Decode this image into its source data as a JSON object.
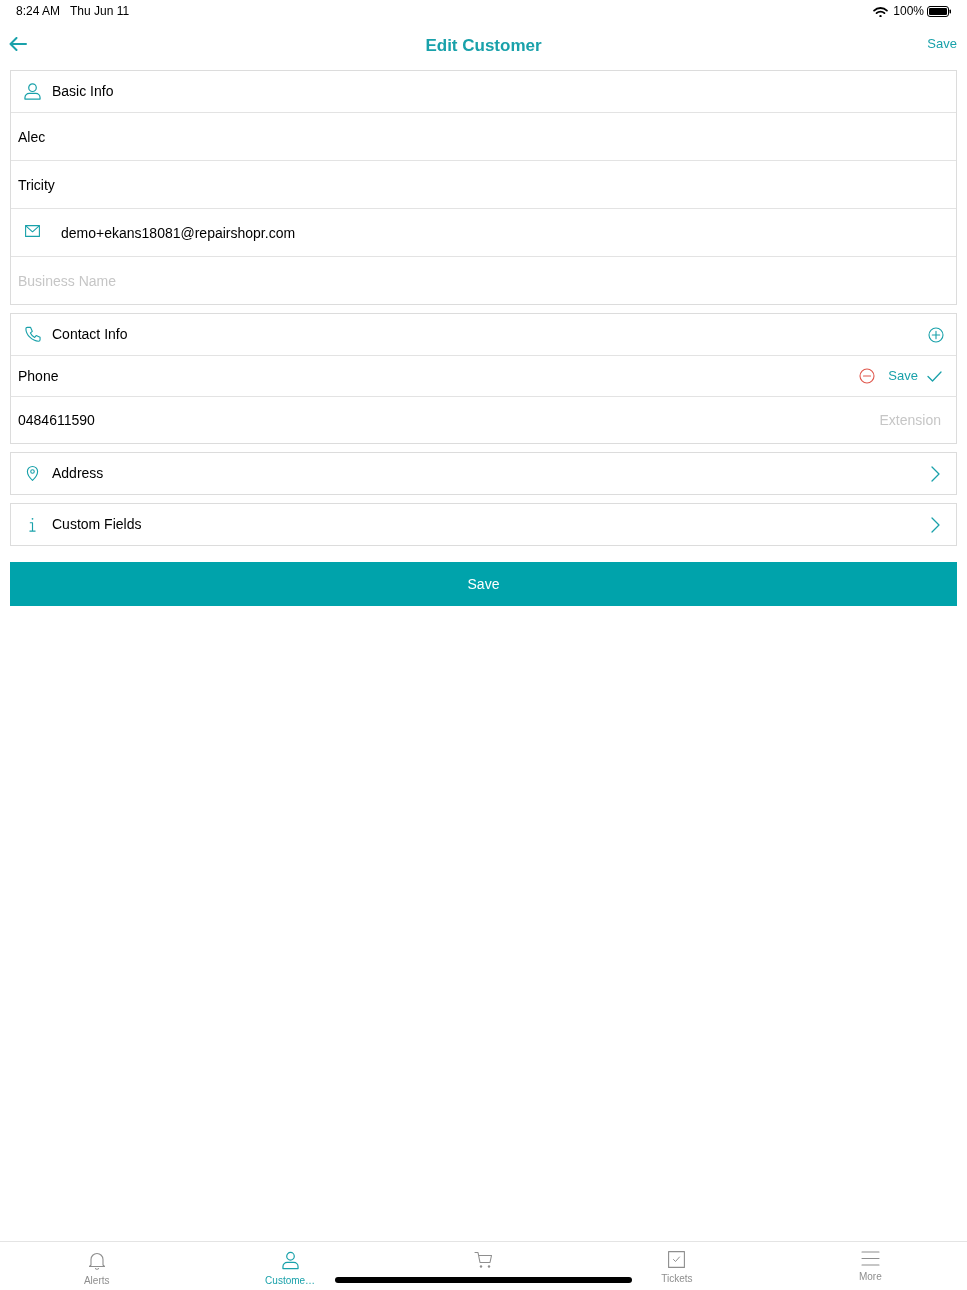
{
  "status_bar": {
    "time": "8:24 AM",
    "date": "Thu Jun 11",
    "battery": "100%"
  },
  "nav_bar": {
    "title": "Edit Customer",
    "action": "Save"
  },
  "sections": [
    {
      "kind": "form",
      "title": "Basic Info",
      "rows": [
        {
          "kind": "input",
          "value": "Alec"
        },
        {
          "kind": "input",
          "value": "Tricity"
        },
        {
          "kind": "email",
          "value": "demo+ekans18081@repairshopr.com"
        },
        {
          "kind": "input",
          "placeholder": "Business Name"
        }
      ]
    },
    {
      "kind": "contacts",
      "title": "Contact Info",
      "phones": [
        {
          "label": "Phone",
          "save": "Save",
          "number": "0484611590",
          "extension_placeholder": "Extension"
        }
      ]
    },
    {
      "kind": "link",
      "title": "Address"
    },
    {
      "kind": "link",
      "title": "Custom Fields"
    }
  ],
  "save_button": "Save",
  "tab_bar": [
    {
      "label": "Alerts",
      "selected": false
    },
    {
      "label": "Custome…",
      "selected": true
    },
    {
      "selected": false
    },
    {
      "label": "Tickets",
      "selected": false
    },
    {
      "label": "More",
      "selected": false
    }
  ]
}
